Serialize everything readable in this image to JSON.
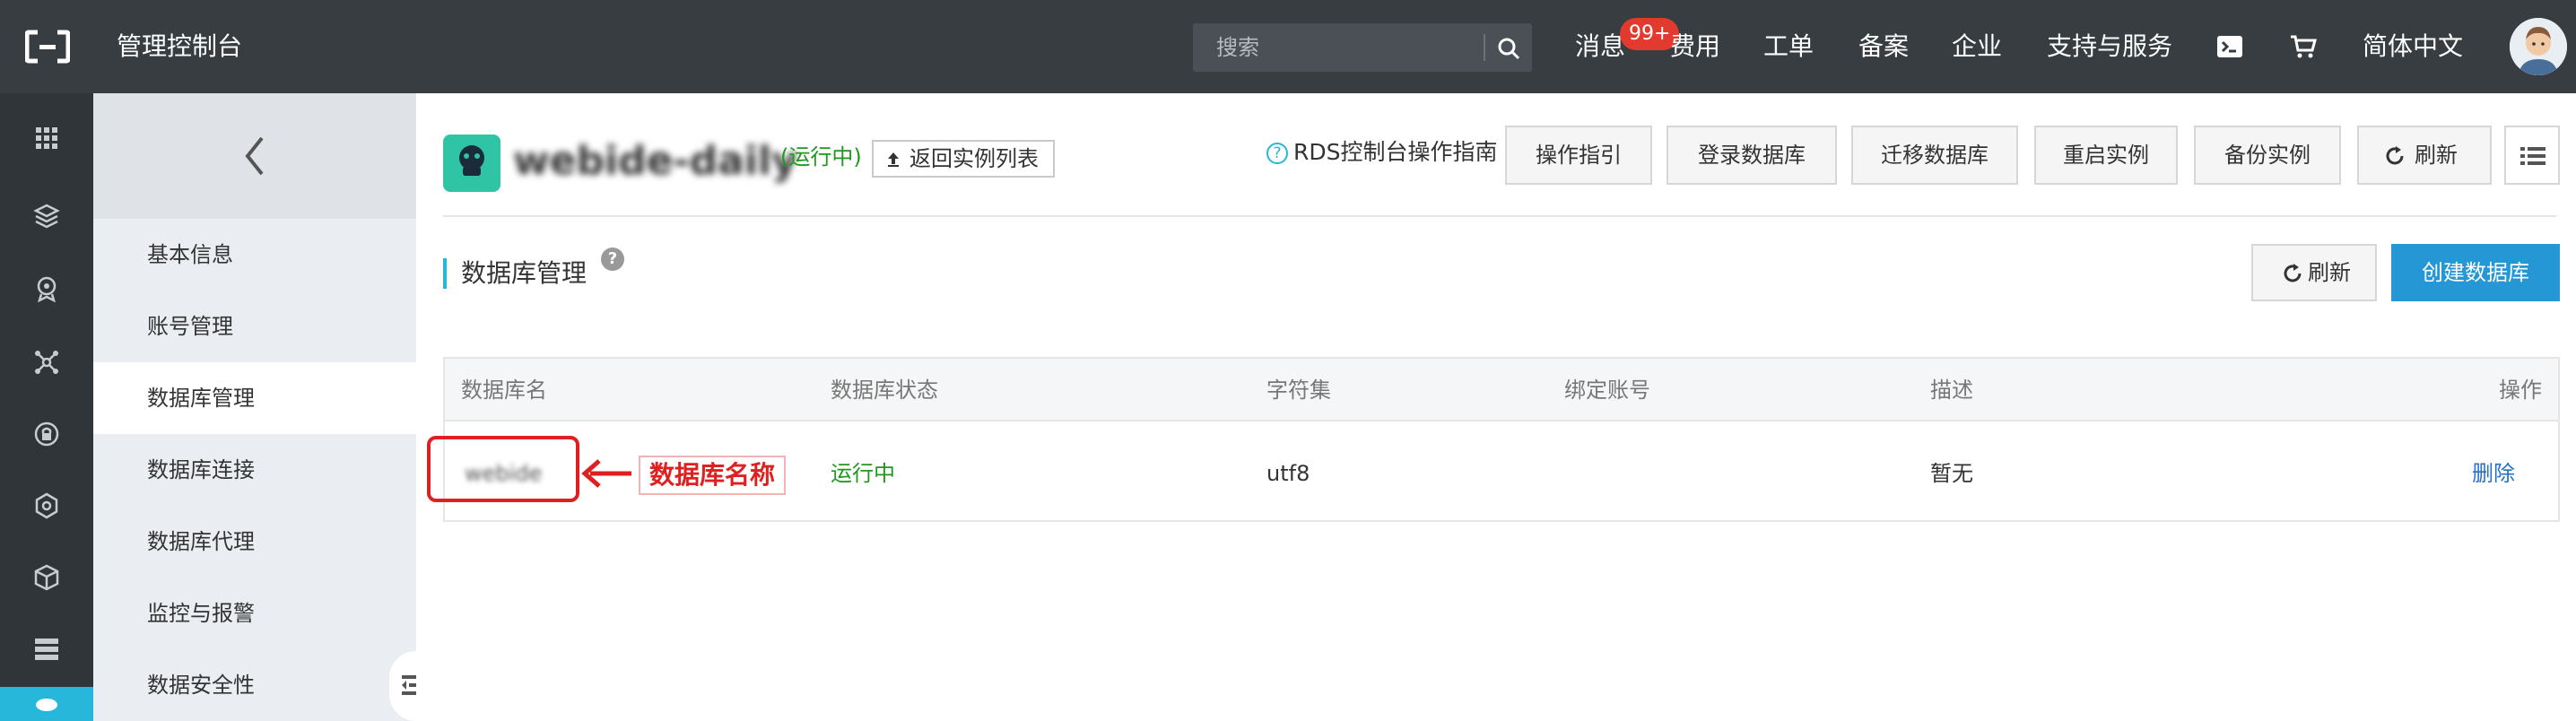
{
  "topbar": {
    "title": "管理控制台",
    "search_placeholder": "搜索",
    "nav": {
      "messages": "消息",
      "messages_badge": "99+",
      "billing": "费用",
      "tickets": "工单",
      "icp": "备案",
      "enterprise": "企业",
      "support": "支持与服务",
      "language": "简体中文"
    }
  },
  "sidebar": {
    "items": [
      {
        "label": "基本信息"
      },
      {
        "label": "账号管理"
      },
      {
        "label": "数据库管理"
      },
      {
        "label": "数据库连接"
      },
      {
        "label": "数据库代理"
      },
      {
        "label": "监控与报警"
      },
      {
        "label": "数据安全性"
      }
    ]
  },
  "instance": {
    "name": "webide-daily",
    "status": "(运行中)",
    "back_to_list": "返回实例列表",
    "guide": "RDS控制台操作指南",
    "actions": [
      "操作指引",
      "登录数据库",
      "迁移数据库",
      "重启实例",
      "备份实例",
      "刷新"
    ]
  },
  "section": {
    "title": "数据库管理",
    "help": "?",
    "refresh": "刷新",
    "create": "创建数据库"
  },
  "table": {
    "columns": [
      "数据库名",
      "数据库状态",
      "字符集",
      "绑定账号",
      "描述",
      "操作"
    ],
    "rows": [
      {
        "name": "webide",
        "status": "运行中",
        "charset": "utf8",
        "account": "",
        "desc": "暂无",
        "action": "删除"
      }
    ]
  },
  "annotation": {
    "label": "数据库名称"
  },
  "colors": {
    "topbar": "#373d41",
    "accent": "#26b7da",
    "primary_button": "#2597d4",
    "running": "#1e9a1e",
    "annotation": "#e02020",
    "link": "#2570c8"
  }
}
